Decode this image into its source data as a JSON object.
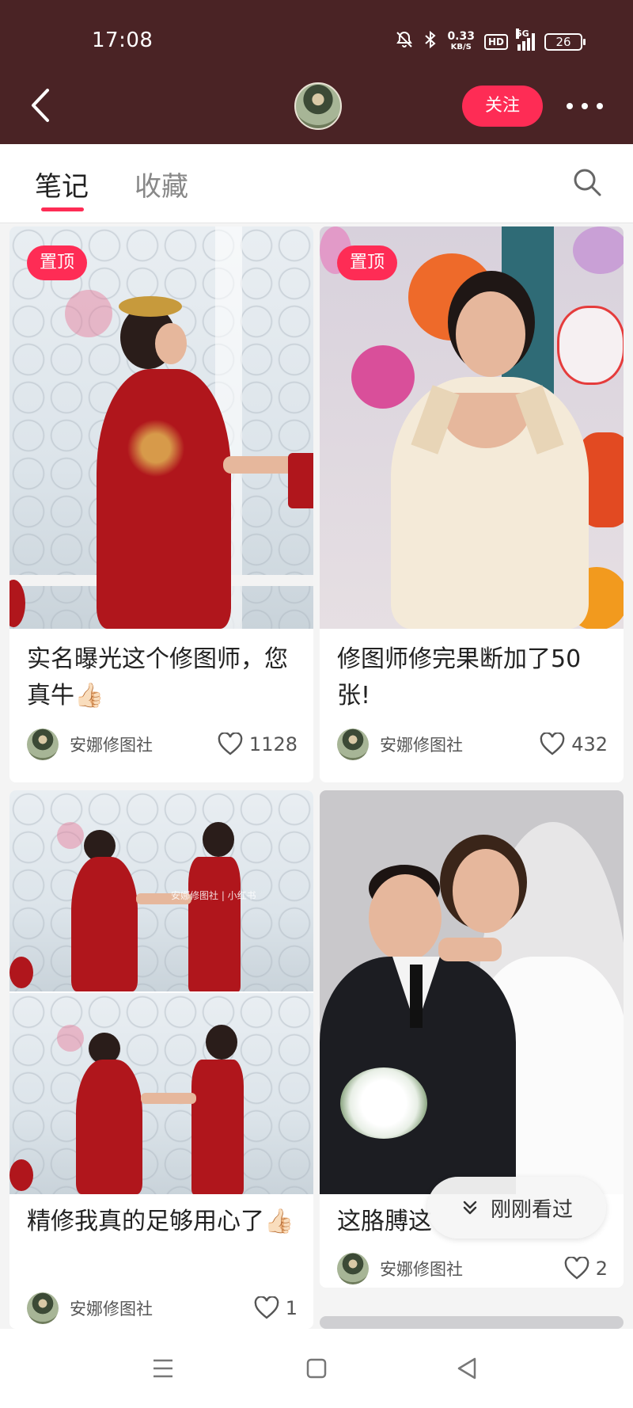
{
  "status_bar": {
    "time": "17:08",
    "net_speed_value": "0.33",
    "net_speed_unit": "KB/S",
    "hd_label": "HD",
    "network_label": "5G",
    "battery": "26"
  },
  "header": {
    "follow_label": "关注"
  },
  "tabs": [
    {
      "label": "笔记",
      "active": true
    },
    {
      "label": "收藏",
      "active": false
    }
  ],
  "notes": [
    {
      "pinned_label": "置顶",
      "title": "实名曝光这个修图师，您真牛👍🏻",
      "author": "安娜修图社",
      "likes": "1128"
    },
    {
      "pinned_label": "置顶",
      "title": "修图师修完果断加了50张!",
      "author": "安娜修图社",
      "likes": "432"
    },
    {
      "title": "精修我真的足够用心了👍🏻",
      "author": "安娜修图社",
      "likes": "1",
      "watermark": "安娜修图社 | 小红书"
    },
    {
      "title": "这胳膊这",
      "author": "安娜修图社",
      "likes": "2"
    }
  ],
  "floating_button": {
    "label": "刚刚看过"
  },
  "colors": {
    "brand": "#fe2c55",
    "header_bg": "#4a2325"
  }
}
